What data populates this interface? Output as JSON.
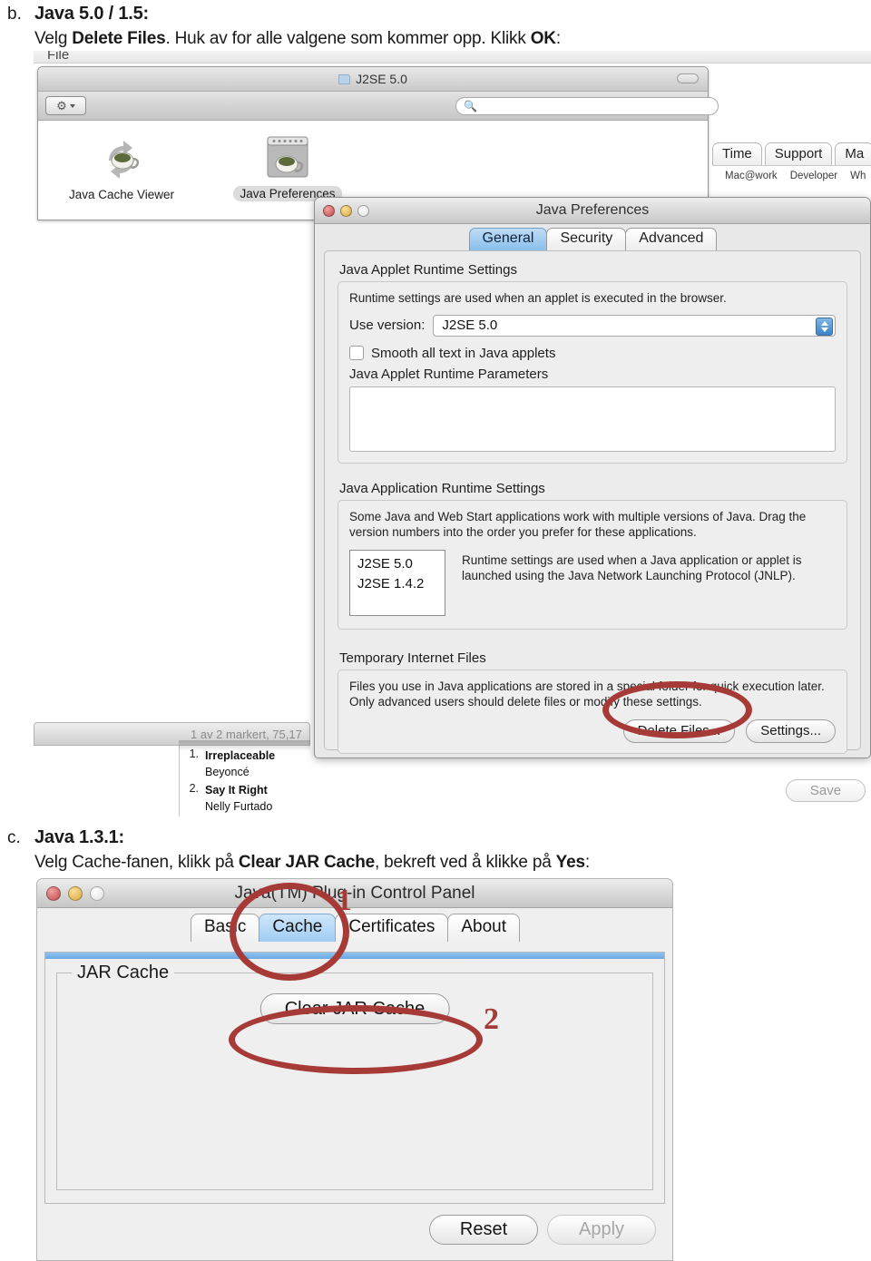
{
  "document": {
    "section_b": {
      "marker": "b.",
      "heading": "Java 5.0 / 1.5:",
      "instruction_parts": {
        "p1": "Velg ",
        "b1": "Delete Files",
        "p2": ". Huk av for alle valgene som kommer opp. Klikk ",
        "b2": "OK",
        "p3": ":"
      }
    },
    "section_c": {
      "marker": "c.",
      "heading": "Java 1.3.1:",
      "instruction_parts": {
        "p1": "Velg Cache-fanen, klikk på ",
        "b1": "Clear JAR Cache",
        "p2": ", bekreft ved å klikke på ",
        "b2": "Yes",
        "p3": ":"
      }
    }
  },
  "screenshot1": {
    "menubar": {
      "file": "File"
    },
    "finder": {
      "title": "J2SE 5.0",
      "folder_icon": "folder-icon",
      "gear_icon": "gear-icon",
      "search_icon": "search-icon",
      "search_value": "",
      "items": [
        {
          "label": "Java Cache Viewer",
          "icon": "java-cache-viewer-icon",
          "selected": false
        },
        {
          "label": "Java Preferences",
          "icon": "java-preferences-icon",
          "selected": true
        }
      ]
    },
    "webstrip": {
      "tabs": [
        "Time",
        "Support",
        "Ma"
      ],
      "sublinks": [
        "Mac@work",
        "Developer",
        "Wh"
      ]
    },
    "itunes": {
      "status": "1 av 2 markert, 75,17",
      "tracks": [
        {
          "num": "1.",
          "title": "Irreplaceable",
          "artist": "Beyoncé"
        },
        {
          "num": "2.",
          "title": "Say It Right",
          "artist": "Nelly Furtado"
        }
      ]
    },
    "save_button": "Save",
    "dialog": {
      "title": "Java Preferences",
      "window_controls": [
        "close-button",
        "minimize-button",
        "zoom-button"
      ],
      "tabs": [
        {
          "label": "General",
          "active": true
        },
        {
          "label": "Security",
          "active": false
        },
        {
          "label": "Advanced",
          "active": false
        }
      ],
      "applet_runtime": {
        "group_label": "Java Applet Runtime Settings",
        "description": "Runtime settings are used when an applet is executed in the browser.",
        "use_version_label": "Use version:",
        "use_version_value": "J2SE 5.0",
        "smooth_text_label": "Smooth all text in Java applets",
        "smooth_text_checked": false,
        "parameters_label": "Java Applet Runtime Parameters",
        "parameters_value": ""
      },
      "application_runtime": {
        "group_label": "Java Application Runtime Settings",
        "description": "Some Java and Web Start applications work with multiple versions of Java. Drag the version numbers into the order you prefer for these applications.",
        "versions": [
          "J2SE 5.0",
          "J2SE 1.4.2"
        ],
        "note": "Runtime settings are used when a Java application or applet is launched using the Java Network Launching Protocol (JNLP)."
      },
      "temporary_files": {
        "group_label": "Temporary Internet Files",
        "description": "Files you use in Java applications are stored in a special folder for quick execution later.  Only advanced users should delete files or modify these settings.",
        "delete_button": "Delete Files...",
        "settings_button": "Settings..."
      }
    }
  },
  "screenshot2": {
    "title": "Java(TM) Plug-in Control Panel",
    "window_controls": [
      "close-button",
      "minimize-button",
      "zoom-button"
    ],
    "tabs": [
      {
        "label": "Basic",
        "active": false
      },
      {
        "label": "Cache",
        "active": true
      },
      {
        "label": "Certificates",
        "active": false
      },
      {
        "label": "About",
        "active": false
      }
    ],
    "jar_cache": {
      "legend": "JAR Cache",
      "clear_button": "Clear JAR Cache"
    },
    "footer": {
      "reset_button": "Reset",
      "apply_button": "Apply",
      "apply_disabled": true
    },
    "annotations": [
      {
        "label": "1",
        "target": "cache-tab"
      },
      {
        "label": "2",
        "target": "clear-jar-cache-button"
      }
    ]
  },
  "colors": {
    "annotation_red": "#a63a36",
    "tab_active_blue": "#89bfec",
    "text": "#1a1a1a"
  }
}
